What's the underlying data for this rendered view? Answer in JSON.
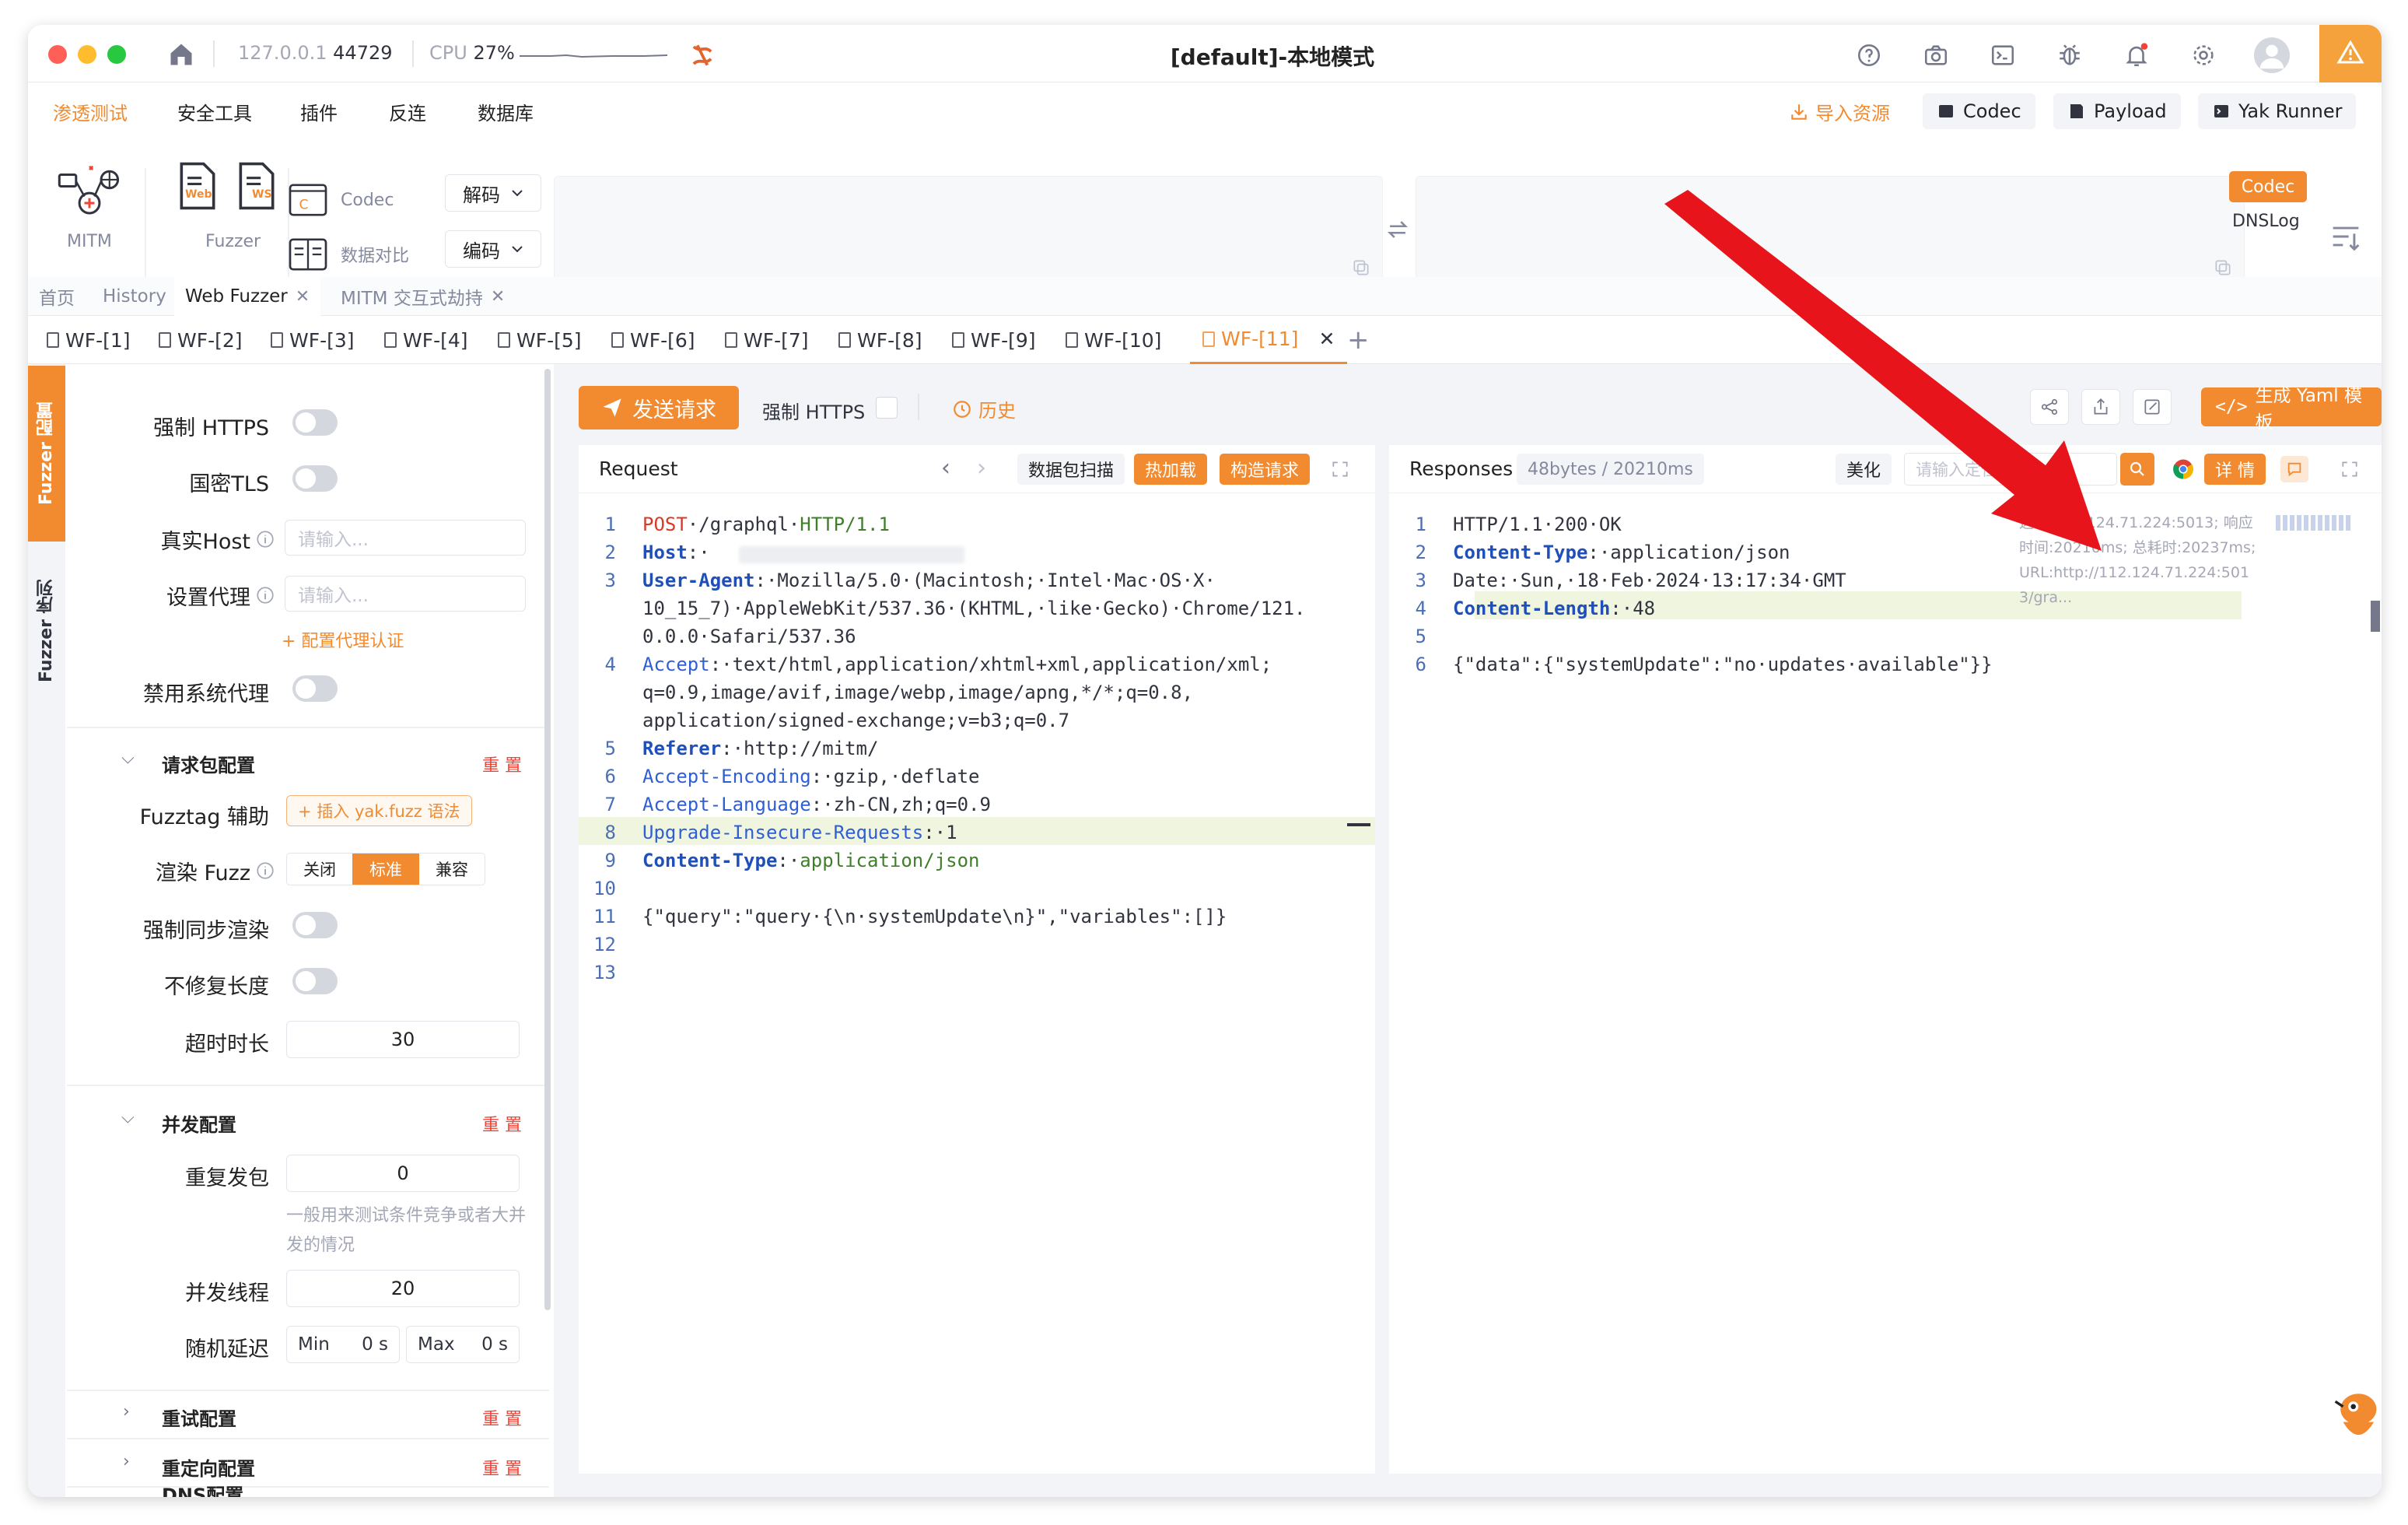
{
  "window": {
    "title": "[default]-本地模式",
    "host": "127.0.0.1",
    "port": "44729",
    "cpu_label": "CPU",
    "cpu_value": "27%"
  },
  "menu": {
    "items": [
      "渗透测试",
      "安全工具",
      "插件",
      "反连",
      "数据库"
    ],
    "right": {
      "import": "导入资源",
      "codec": "Codec",
      "payload": "Payload",
      "yak_runner": "Yak Runner"
    }
  },
  "tools": {
    "mitm": "MITM",
    "fuzzer": "Fuzzer",
    "web_icon": "Web",
    "ws_icon": "WS",
    "codec": "Codec",
    "compare": "数据对比",
    "decode": "解码",
    "encode": "编码",
    "side_codec": "Codec",
    "side_dnslog": "DNSLog"
  },
  "tabs": {
    "primary": [
      "首页",
      "History",
      "Web Fuzzer",
      "MITM 交互式劫持"
    ],
    "secondary": [
      "WF-[1]",
      "WF-[2]",
      "WF-[3]",
      "WF-[4]",
      "WF-[5]",
      "WF-[6]",
      "WF-[7]",
      "WF-[8]",
      "WF-[9]",
      "WF-[10]",
      "WF-[11]"
    ],
    "add": "+"
  },
  "vtabs": {
    "config": "Fuzzer 配置",
    "sequence": "Fuzzer 序列"
  },
  "config": {
    "force_https": "强制 HTTPS",
    "gm_tls": "国密TLS",
    "real_host": "真实Host",
    "real_host_placeholder": "请输入...",
    "proxy": "设置代理",
    "proxy_placeholder": "请输入...",
    "proxy_auth": "+ 配置代理认证",
    "disable_sys_proxy": "禁用系统代理",
    "section_request": "请求包配置",
    "reset": "重 置",
    "fuzztag": "Fuzztag 辅助",
    "fuzztag_btn": "+ 插入 yak.fuzz 语法",
    "render_fuzz": "渲染 Fuzz",
    "render_opts": [
      "关闭",
      "标准",
      "兼容"
    ],
    "render_selected": "标准",
    "force_sync": "强制同步渲染",
    "no_fix_len": "不修复长度",
    "timeout": "超时时长",
    "timeout_value": "30",
    "section_concurrency": "并发配置",
    "repeat": "重复发包",
    "repeat_value": "0",
    "repeat_hint": "一般用来测试条件竞争或者大并发的情况",
    "threads": "并发线程",
    "threads_value": "20",
    "random_delay": "随机延迟",
    "min_label": "Min",
    "min_value": "0",
    "max_label": "Max",
    "max_value": "0",
    "unit": "s",
    "section_retry": "重试配置",
    "section_redirect": "重定向配置",
    "section_dns": "DNS配置"
  },
  "actions": {
    "send": "发送请求",
    "force_https": "强制 HTTPS",
    "history": "历史",
    "gen_yaml": "生成 Yaml 模板"
  },
  "request": {
    "title": "Request",
    "scan": "数据包扫描",
    "hot_load": "热加载",
    "build": "构造请求",
    "lines": [
      {
        "n": "1",
        "parts": [
          [
            "red",
            "POST"
          ],
          [
            "",
            "·/graphql·"
          ],
          [
            "grn",
            "HTTP/1.1"
          ]
        ]
      },
      {
        "n": "2",
        "parts": [
          [
            "key",
            "Host"
          ],
          [
            "",
            ":·"
          ]
        ]
      },
      {
        "n": "3",
        "parts": [
          [
            "key",
            "User-Agent"
          ],
          [
            "",
            ":·Mozilla/5.0·(Macintosh;·Intel·Mac·OS·X·"
          ]
        ]
      },
      {
        "n": "",
        "parts": [
          [
            "",
            "10_15_7)·AppleWebKit/537.36·(KHTML,·like·Gecko)·Chrome/121."
          ]
        ]
      },
      {
        "n": "",
        "parts": [
          [
            "",
            "0.0.0·Safari/537.36"
          ]
        ]
      },
      {
        "n": "4",
        "parts": [
          [
            "kw",
            "Accept"
          ],
          [
            "",
            ":·text/html,application/xhtml+xml,application/xml;"
          ]
        ]
      },
      {
        "n": "",
        "parts": [
          [
            "",
            "q=0.9,image/avif,image/webp,image/apng,*/*;q=0.8,"
          ]
        ]
      },
      {
        "n": "",
        "parts": [
          [
            "",
            "application/signed-exchange;v=b3;q=0.7"
          ]
        ]
      },
      {
        "n": "5",
        "parts": [
          [
            "key",
            "Referer"
          ],
          [
            "",
            ":·http://mitm/"
          ]
        ]
      },
      {
        "n": "6",
        "parts": [
          [
            "kw",
            "Accept-Encoding"
          ],
          [
            "",
            ":·gzip,·deflate"
          ]
        ]
      },
      {
        "n": "7",
        "parts": [
          [
            "kw",
            "Accept-Language"
          ],
          [
            "",
            ":·zh-CN,zh;q=0.9"
          ]
        ]
      },
      {
        "n": "8",
        "parts": [
          [
            "kw",
            "Upgrade-Insecure-Requests"
          ],
          [
            "",
            ":·1"
          ]
        ]
      },
      {
        "n": "9",
        "parts": [
          [
            "key",
            "Content-Type"
          ],
          [
            "",
            ":·"
          ],
          [
            "grn",
            "application/json"
          ]
        ]
      },
      {
        "n": "10",
        "parts": []
      },
      {
        "n": "11",
        "parts": [
          [
            "",
            "{\"query\":\"query·{\\n·systemUpdate\\n}\",\"variables\":[]}"
          ]
        ]
      },
      {
        "n": "12",
        "parts": []
      },
      {
        "n": "13",
        "parts": []
      }
    ]
  },
  "response": {
    "title": "Responses",
    "meta": "48bytes / 20210ms",
    "beautify": "美化",
    "search_placeholder": "请输入定位",
    "details": "详 情",
    "info": "远端:112.124.71.224:5013; 响应时间:20210ms; 总耗时:20237ms; URL:http://112.124.71.224:5013/gra...",
    "lines": [
      {
        "n": "1",
        "parts": [
          [
            "",
            "HTTP/1.1·200·OK"
          ]
        ]
      },
      {
        "n": "2",
        "parts": [
          [
            "key",
            "Content-Type"
          ],
          [
            "",
            ":·application/json"
          ]
        ]
      },
      {
        "n": "3",
        "parts": [
          [
            "",
            "Date:·Sun,·18·Feb·2024·13:17:34·GMT"
          ]
        ]
      },
      {
        "n": "4",
        "parts": [
          [
            "key",
            "Content-Length"
          ],
          [
            "",
            ":·48"
          ]
        ]
      },
      {
        "n": "5",
        "parts": []
      },
      {
        "n": "6",
        "parts": [
          [
            "",
            "{\"data\":{\"systemUpdate\":\"no·updates·available\"}}"
          ]
        ]
      }
    ]
  },
  "colors": {
    "accent": "#f28b30",
    "danger": "#f04438",
    "arrow": "#e8141c"
  }
}
